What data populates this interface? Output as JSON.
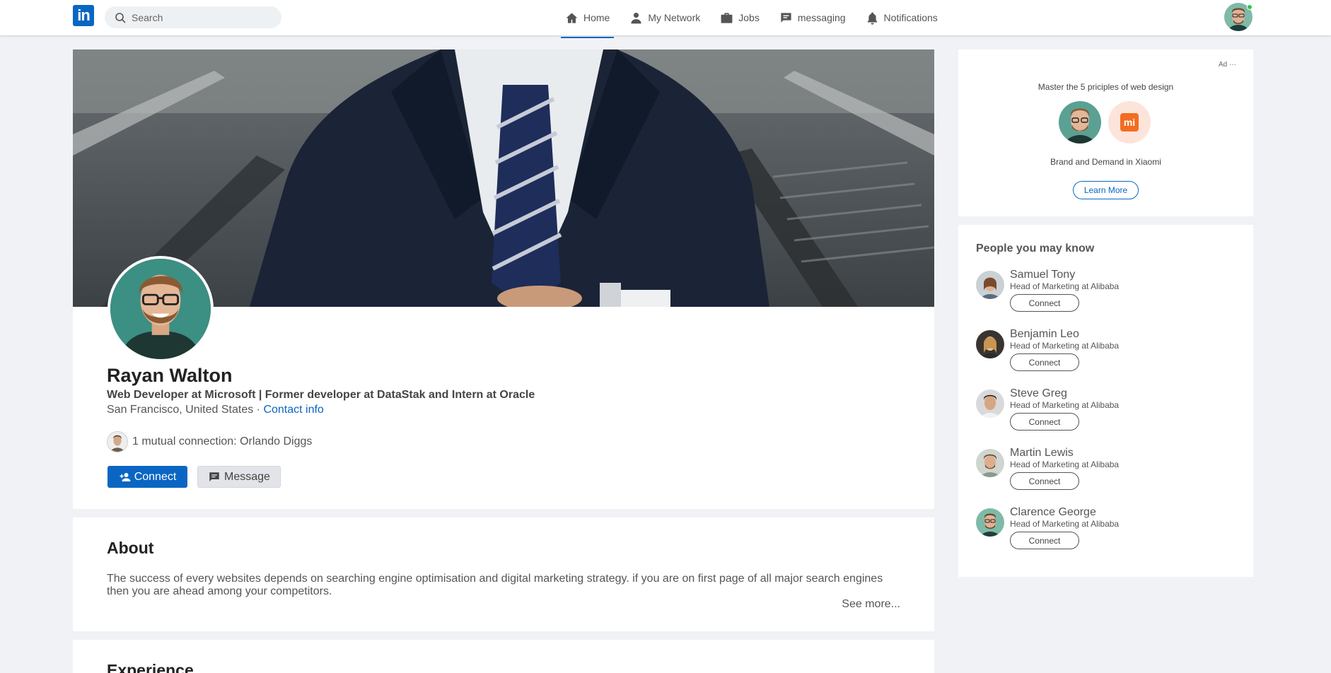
{
  "nav": {
    "logo": "in",
    "search_placeholder": "Search",
    "links": [
      {
        "label": "Home",
        "icon": "home-icon",
        "active": true
      },
      {
        "label": "My Network",
        "icon": "person-icon"
      },
      {
        "label": "Jobs",
        "icon": "briefcase-icon"
      },
      {
        "label": "messaging",
        "icon": "chat-icon"
      },
      {
        "label": "Notifications",
        "icon": "bell-icon"
      }
    ]
  },
  "profile": {
    "name": "Rayan Walton",
    "headline": "Web Developer at Microsoft | Former developer at DataStak and Intern at Oracle",
    "location": "San Francisco, United States",
    "separator": " · ",
    "contact_link": "Contact info",
    "mutual": "1 mutual connection: Orlando Diggs",
    "connect_label": "Connect",
    "message_label": "Message"
  },
  "about": {
    "title": "About",
    "text": "The success of every websites depends on searching engine optimisation and digital marketing strategy. if you are on first page of all major search engines then you are ahead among your competitors.",
    "see_more": "See more..."
  },
  "experience": {
    "title": "Experience"
  },
  "ad": {
    "label": "Ad ···",
    "headline": "Master the 5 priciples of web design",
    "caption": "Brand and Demand in Xiaomi",
    "logo_text": "mi",
    "cta": "Learn More"
  },
  "people": {
    "title": "People you may know",
    "connect_label": "Connect",
    "items": [
      {
        "name": "Samuel Tony",
        "role": "Head of Marketing at Alibaba"
      },
      {
        "name": "Benjamin Leo",
        "role": "Head of Marketing at Alibaba"
      },
      {
        "name": "Steve Greg",
        "role": "Head of Marketing at Alibaba"
      },
      {
        "name": "Martin Lewis",
        "role": "Head of Marketing at Alibaba"
      },
      {
        "name": "Clarence George",
        "role": "Head of Marketing at Alibaba"
      }
    ]
  },
  "colors": {
    "brand": "#0a66c2",
    "background": "#f1f2f6",
    "online": "#2fc54a"
  }
}
